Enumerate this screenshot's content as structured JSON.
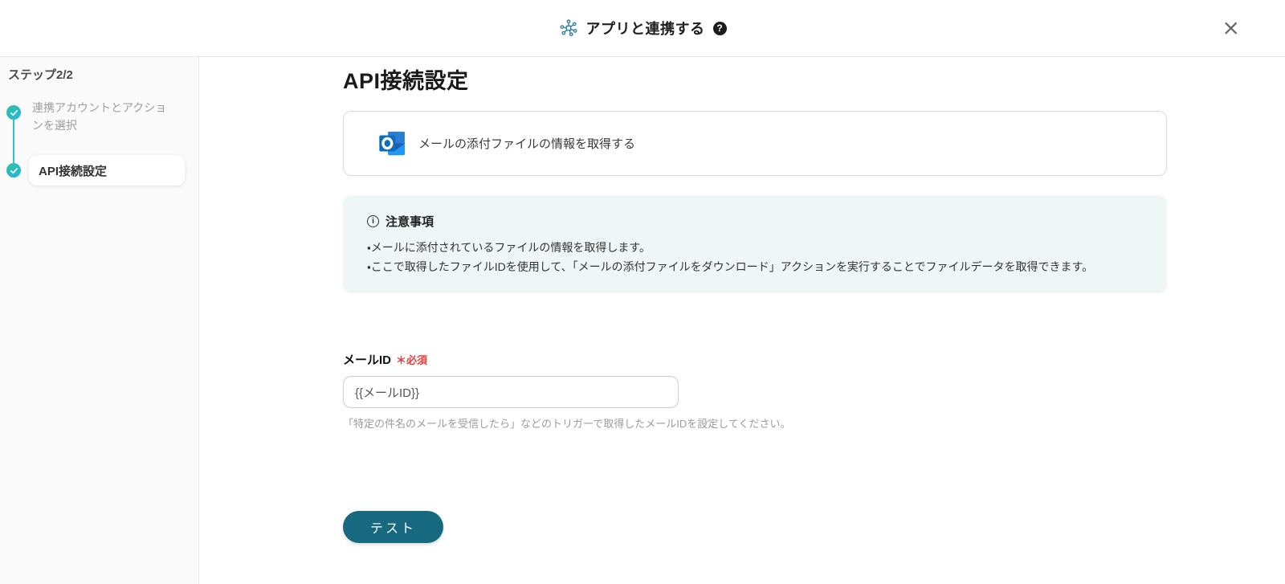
{
  "header": {
    "title": "アプリと連携する",
    "help": "?",
    "close": "×"
  },
  "sidebar": {
    "step_label": "ステップ2/2",
    "steps": [
      {
        "label": "連携アカウントとアクションを選択",
        "state": "completed"
      },
      {
        "label": "API接続設定",
        "state": "active"
      }
    ]
  },
  "main": {
    "title": "API接続設定",
    "action_card": {
      "app": "Outlook",
      "label": "メールの添付ファイルの情報を取得する"
    },
    "notice": {
      "title": "注意事項",
      "lines": [
        "・メールに添付されているファイルの情報を取得します。",
        "・ここで取得したファイルIDを使用して、「メールの添付ファイルをダウンロード」アクションを実行することでファイルデータを取得できます。"
      ]
    },
    "field": {
      "label": "メールID",
      "required": "＊必須",
      "value": "{{メールID}}",
      "helper": "「特定の件名のメールを受信したら」などのトリガーで取得したメールIDを設定してください。"
    },
    "test_button": "テスト"
  },
  "icons": {
    "integration-icon": "network-hub",
    "help-icon": "?",
    "close-icon": "×",
    "check-icon": "✓",
    "info-icon": "i",
    "outlook-icon": "outlook-logo"
  },
  "colors": {
    "accent_teal": "#2ac3cf",
    "check_gradient_start": "#2ec3a2",
    "check_gradient_end": "#28b2e0",
    "button_teal": "#17697f",
    "notice_bg": "#eef7f5",
    "required_red": "#e03e3e",
    "outlook_blue": "#0f6cbd"
  }
}
